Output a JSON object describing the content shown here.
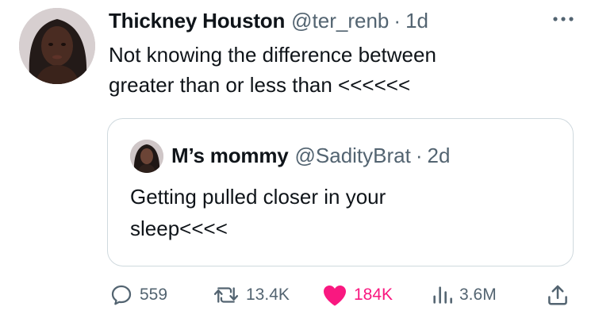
{
  "tweet": {
    "author_name": "Thickney Houston",
    "author_handle": "@ter_renb",
    "separator": "·",
    "time": "1d",
    "text": "Not knowing the difference between\ngreater than or less than <<<<<<"
  },
  "quoted_tweet": {
    "author_name": "M’s mommy",
    "author_handle": "@SadityBrat",
    "separator": "·",
    "time": "2d",
    "text": "Getting pulled closer in your\nsleep<<<<"
  },
  "actions": {
    "replies": "559",
    "retweets": "13.4K",
    "likes": "184K",
    "views": "3.6M"
  },
  "icons": {
    "more": "more-horizontal-icon",
    "reply": "reply-bubble-icon",
    "retweet": "retweet-icon",
    "like": "heart-filled-icon",
    "views": "bar-chart-icon",
    "share": "share-upload-icon"
  },
  "colors": {
    "text": "#0f1419",
    "secondary": "#536471",
    "like": "#f91880",
    "border": "#cfd9de"
  }
}
